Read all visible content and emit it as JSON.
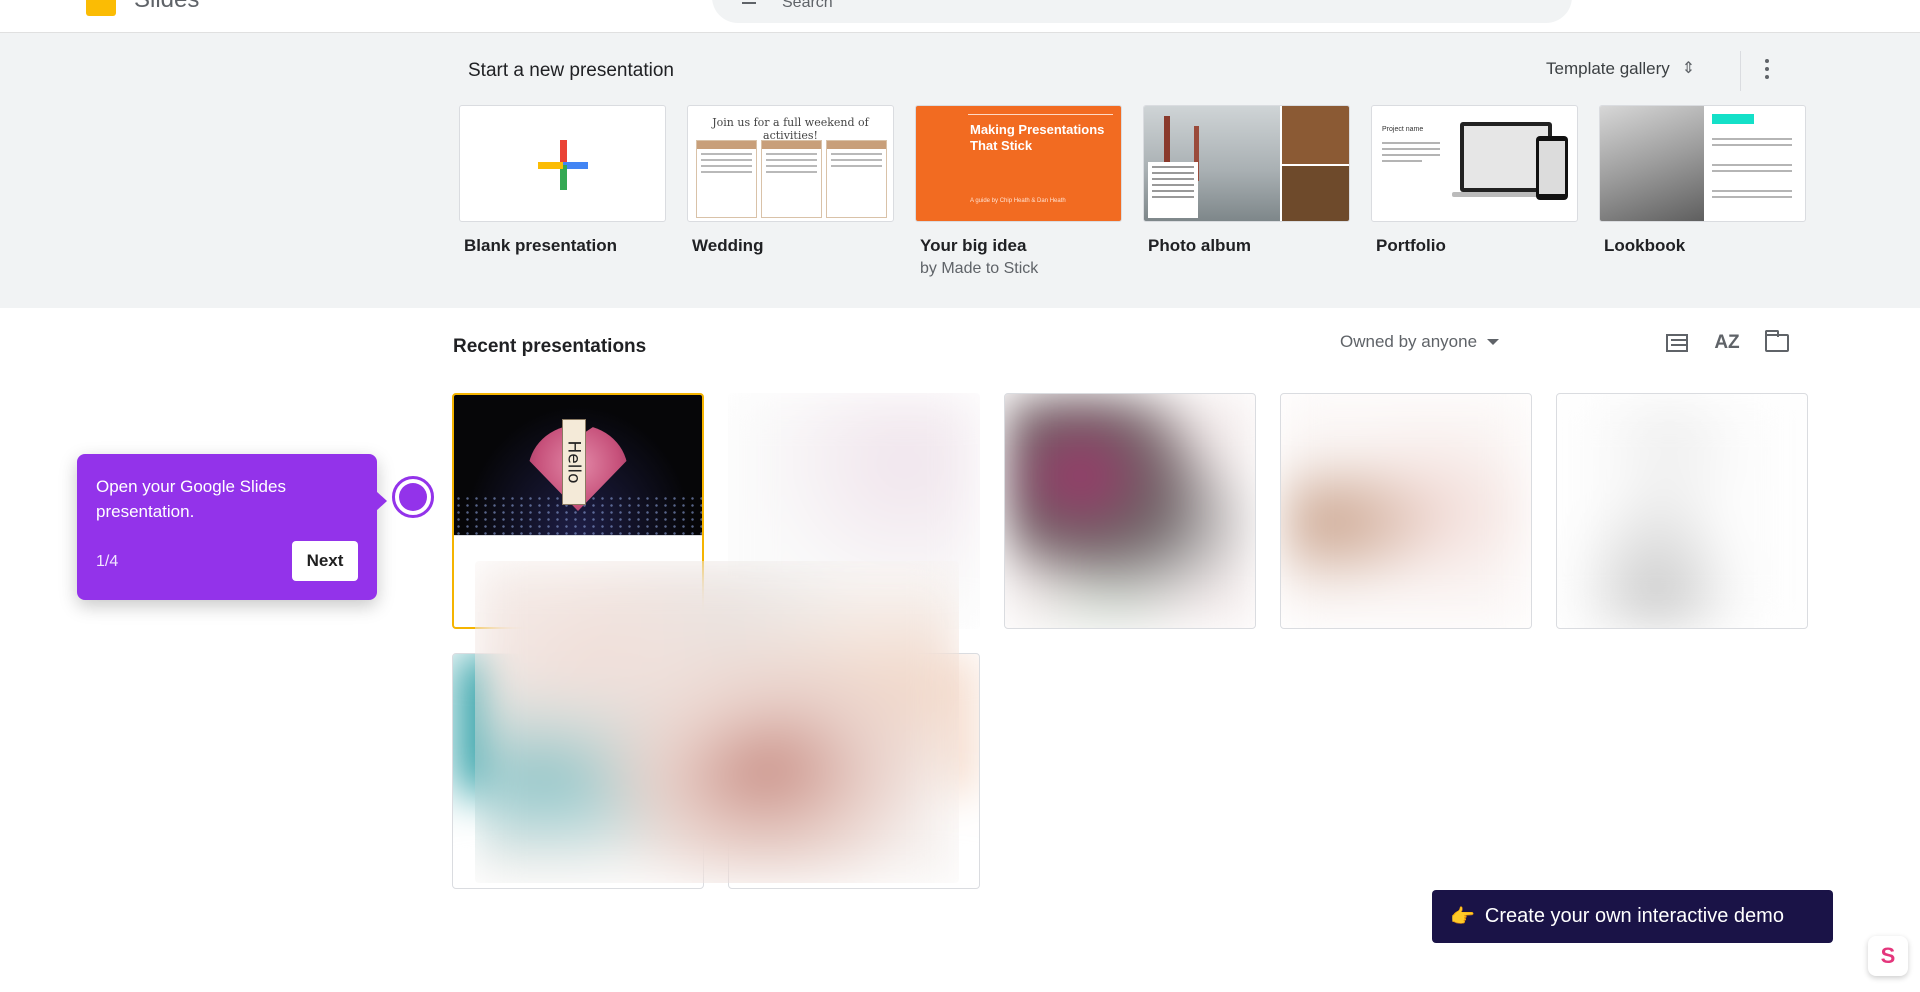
{
  "header": {
    "app_name": "Slides",
    "search_placeholder": "Search"
  },
  "templates": {
    "title": "Start a new presentation",
    "gallery_label": "Template gallery",
    "items": [
      {
        "name": "Blank presentation",
        "sub": ""
      },
      {
        "name": "Wedding",
        "sub": "",
        "thumb_title": "Join us for a full weekend of activities!"
      },
      {
        "name": "Your big idea",
        "sub": "by Made to Stick",
        "thumb_title": "Making Presentations That Stick",
        "thumb_sub": "A guide by Chip Heath & Dan Heath"
      },
      {
        "name": "Photo album",
        "sub": ""
      },
      {
        "name": "Portfolio",
        "sub": "",
        "thumb_title": "Project name"
      },
      {
        "name": "Lookbook",
        "sub": ""
      }
    ]
  },
  "recent": {
    "title": "Recent presentations",
    "owner_filter": "Owned by anyone",
    "sort_glyph": "AZ",
    "first_thumb_text": "Hello"
  },
  "tour": {
    "text": "Open your Google Slides presentation.",
    "step": "1/4",
    "next_label": "Next"
  },
  "cta": {
    "label": "Create your own interactive demo",
    "emoji": "👉"
  },
  "colors": {
    "tour_purple": "#9333ea",
    "cta_navy": "#1a1347",
    "band_gray": "#f1f3f4",
    "selected_border": "#f5b400"
  }
}
